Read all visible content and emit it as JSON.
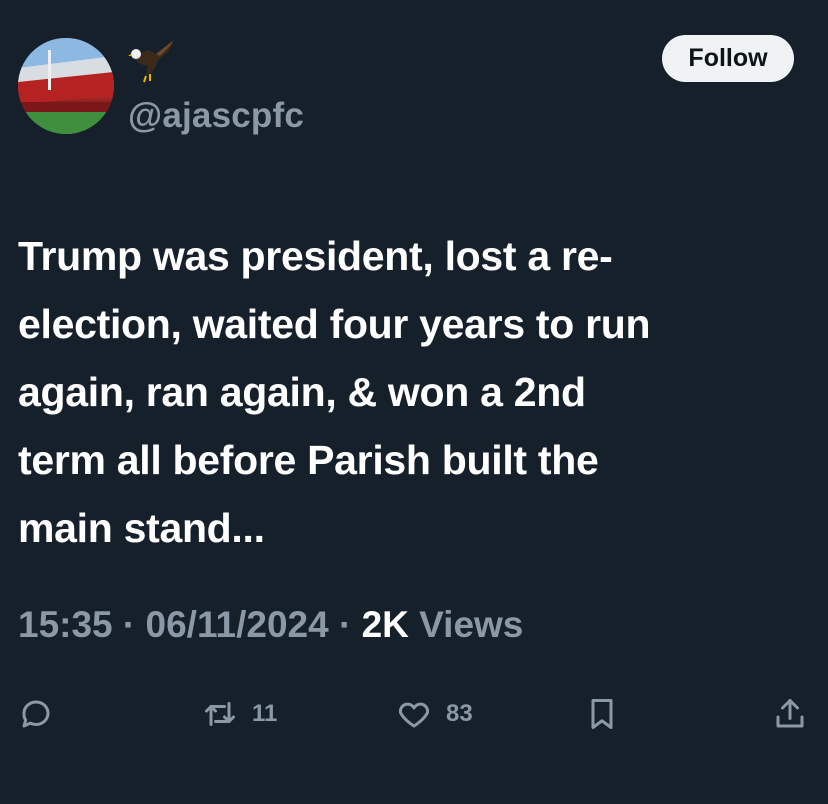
{
  "header": {
    "handle": "@ajascpfc",
    "follow_label": "Follow"
  },
  "tweet": {
    "text": "Trump was president, lost a re-\nelection, waited four years to run\nagain, ran again, & won a 2nd\nterm all before Parish built the\nmain stand..."
  },
  "meta": {
    "time": "15:35",
    "sep1": " · ",
    "date": "06/11/2024",
    "sep2": " · ",
    "views_count": "2K",
    "views_label": " Views"
  },
  "actions": {
    "reply_icon": "reply-icon",
    "retweet_icon": "retweet-icon",
    "retweet_count": "11",
    "like_icon": "heart-icon",
    "like_count": "83",
    "bookmark_icon": "bookmark-icon",
    "share_icon": "share-icon"
  },
  "colors": {
    "background": "#15202b",
    "text_primary": "#ffffff",
    "text_secondary": "#8b98a5",
    "follow_bg": "#eff3f4"
  }
}
